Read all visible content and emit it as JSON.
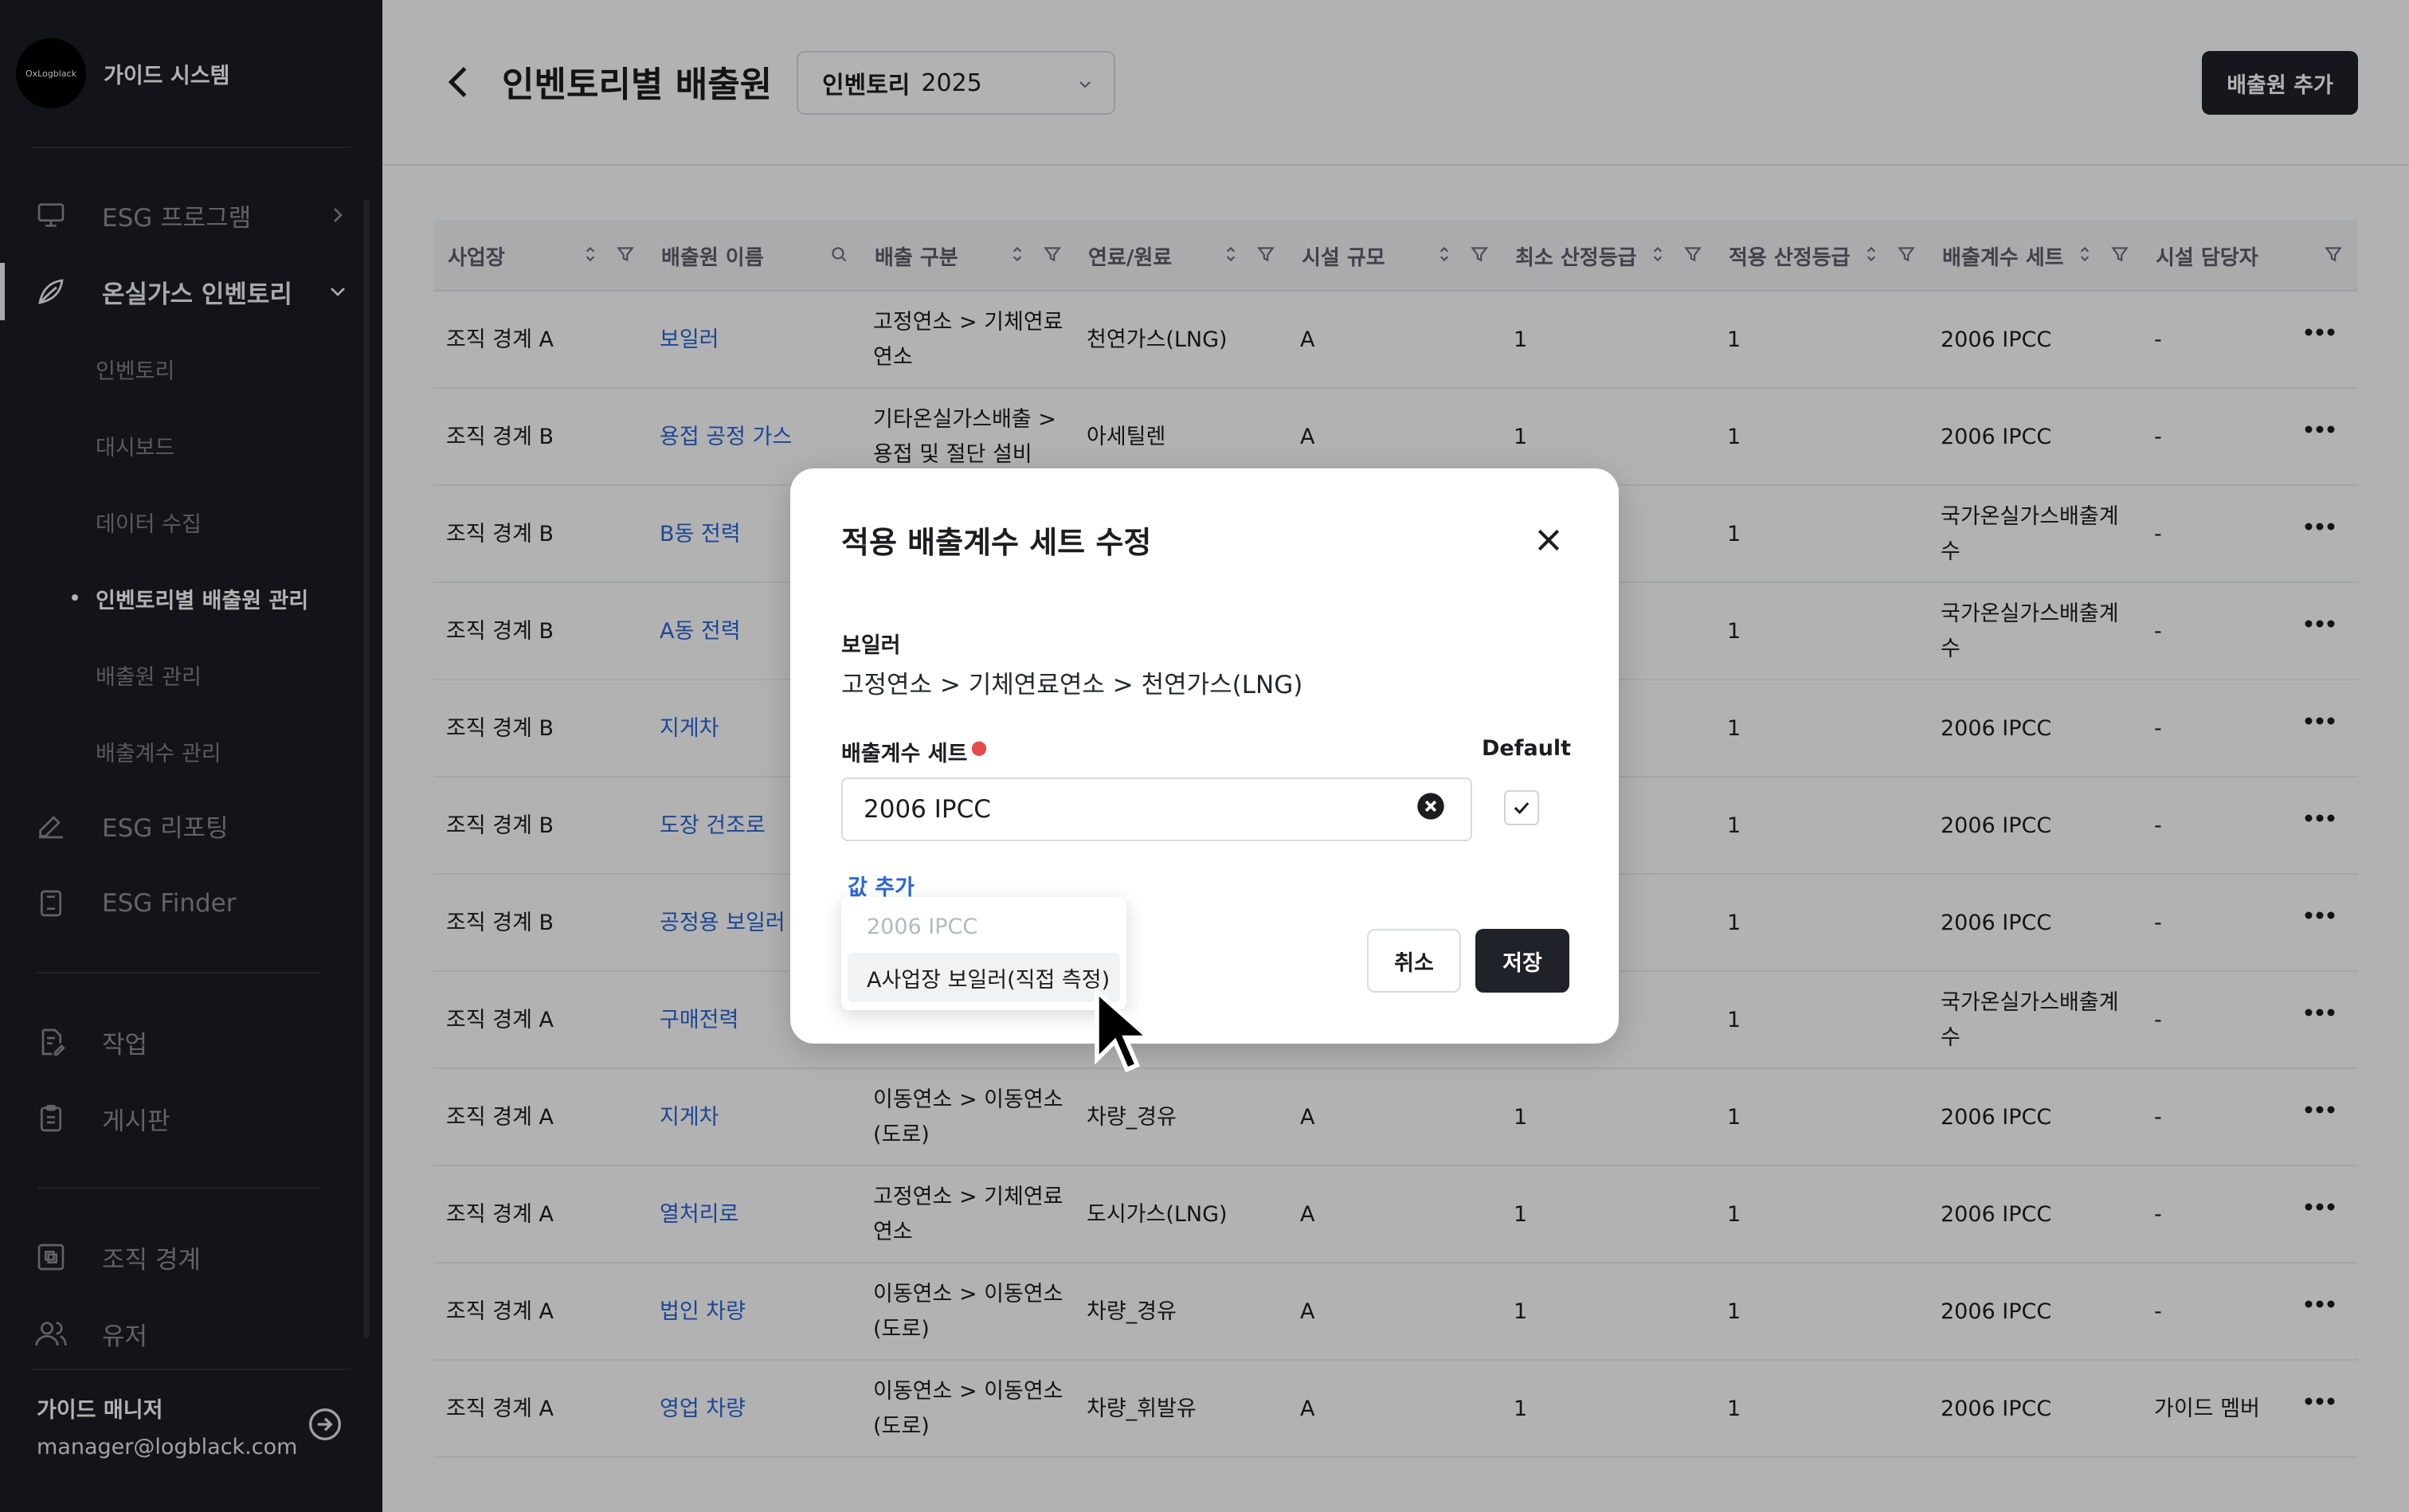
{
  "sidebar": {
    "brand": {
      "logo_text": "OxLogblack",
      "name": "가이드 시스템"
    },
    "nav": [
      {
        "label": "ESG 프로그램",
        "icon": "monitor-icon"
      },
      {
        "label": "온실가스 인벤토리",
        "icon": "leaf-icon"
      },
      {
        "label": "ESG 리포팅",
        "icon": "pen-icon"
      },
      {
        "label": "ESG Finder",
        "icon": "book-icon"
      },
      {
        "label": "작업",
        "icon": "document-edit-icon"
      },
      {
        "label": "게시판",
        "icon": "clipboard-icon"
      },
      {
        "label": "조직 경계",
        "icon": "boundary-icon"
      },
      {
        "label": "유저",
        "icon": "users-icon"
      }
    ],
    "sub_items": [
      "인벤토리",
      "대시보드",
      "데이터 수집",
      "인벤토리별 배출원 관리",
      "배출원 관리",
      "배출계수 관리"
    ],
    "user": {
      "name": "가이드 매니저",
      "email": "manager@logblack.com"
    }
  },
  "header": {
    "title": "인벤토리별 배출원",
    "inventory_label": "인벤토리",
    "inventory_year": "2025",
    "add_button": "배출원 추가"
  },
  "table": {
    "columns": [
      "사업장",
      "배출원 이름",
      "배출 구분",
      "연료/원료",
      "시설 규모",
      "최소 산정등급",
      "적용 산정등급",
      "배출계수 세트",
      "시설 담당자"
    ],
    "rows": [
      {
        "site": "조직 경계 A",
        "name": "보일러",
        "cat1": "고정연소 > 기체연료",
        "cat2": "연소",
        "fuel": "천연가스(LNG)",
        "scale": "A",
        "min": "1",
        "app": "1",
        "set1": "2006 IPCC",
        "set2": "",
        "mgr": "-"
      },
      {
        "site": "조직 경계 B",
        "name": "용접 공정 가스",
        "cat1": "기타온실가스배출 >",
        "cat2": "용접 및 절단 설비",
        "fuel": "아세틸렌",
        "scale": "A",
        "min": "1",
        "app": "1",
        "set1": "2006 IPCC",
        "set2": "",
        "mgr": "-"
      },
      {
        "site": "조직 경계 B",
        "name": "B동 전력",
        "cat1": "",
        "cat2": "",
        "fuel": "",
        "scale": "",
        "min": "",
        "app": "1",
        "set1": "국가온실가스배출계",
        "set2": "수",
        "mgr": "-"
      },
      {
        "site": "조직 경계 B",
        "name": "A동 전력",
        "cat1": "",
        "cat2": "",
        "fuel": "",
        "scale": "",
        "min": "",
        "app": "1",
        "set1": "국가온실가스배출계",
        "set2": "수",
        "mgr": "-"
      },
      {
        "site": "조직 경계 B",
        "name": "지게차",
        "cat1": "",
        "cat2": "",
        "fuel": "",
        "scale": "",
        "min": "",
        "app": "1",
        "set1": "2006 IPCC",
        "set2": "",
        "mgr": "-"
      },
      {
        "site": "조직 경계 B",
        "name": "도장 건조로",
        "cat1": "",
        "cat2": "",
        "fuel": "",
        "scale": "",
        "min": "",
        "app": "1",
        "set1": "2006 IPCC",
        "set2": "",
        "mgr": "-"
      },
      {
        "site": "조직 경계 B",
        "name": "공정용 보일러",
        "cat1": "",
        "cat2": "",
        "fuel": "",
        "scale": "",
        "min": "",
        "app": "1",
        "set1": "2006 IPCC",
        "set2": "",
        "mgr": "-"
      },
      {
        "site": "조직 경계 A",
        "name": "구매전력",
        "cat1": "",
        "cat2": "",
        "fuel": "",
        "scale": "",
        "min": "",
        "app": "1",
        "set1": "국가온실가스배출계",
        "set2": "수",
        "mgr": "-"
      },
      {
        "site": "조직 경계 A",
        "name": "지게차",
        "cat1": "이동연소 > 이동연소",
        "cat2": "(도로)",
        "fuel": "차량_경유",
        "scale": "A",
        "min": "1",
        "app": "1",
        "set1": "2006 IPCC",
        "set2": "",
        "mgr": "-"
      },
      {
        "site": "조직 경계 A",
        "name": "열처리로",
        "cat1": "고정연소 > 기체연료",
        "cat2": "연소",
        "fuel": "도시가스(LNG)",
        "scale": "A",
        "min": "1",
        "app": "1",
        "set1": "2006 IPCC",
        "set2": "",
        "mgr": "-"
      },
      {
        "site": "조직 경계 A",
        "name": "법인 차량",
        "cat1": "이동연소 > 이동연소",
        "cat2": "(도로)",
        "fuel": "차량_경유",
        "scale": "A",
        "min": "1",
        "app": "1",
        "set1": "2006 IPCC",
        "set2": "",
        "mgr": "-"
      },
      {
        "site": "조직 경계 A",
        "name": "영업 차량",
        "cat1": "이동연소 > 이동연소",
        "cat2": "(도로)",
        "fuel": "차량_휘발유",
        "scale": "A",
        "min": "1",
        "app": "1",
        "set1": "2006 IPCC",
        "set2": "",
        "mgr": "가이드 멤버"
      }
    ]
  },
  "modal": {
    "title": "적용 배출계수 세트 수정",
    "source_name": "보일러",
    "source_path": "고정연소 > 기체연료연소 > 천연가스(LNG)",
    "field_label": "배출계수 세트",
    "default_label": "Default",
    "input_value": "2006 IPCC",
    "add_value": "값 추가",
    "cancel": "취소",
    "save": "저장",
    "options": [
      "2006 IPCC",
      "A사업장 보일러(직접 측정)"
    ]
  },
  "colors": {
    "sidebar_bg": "#1b1e25",
    "link": "#2a66d6",
    "primary_btn": "#1f2229",
    "required": "#e44b4b"
  }
}
